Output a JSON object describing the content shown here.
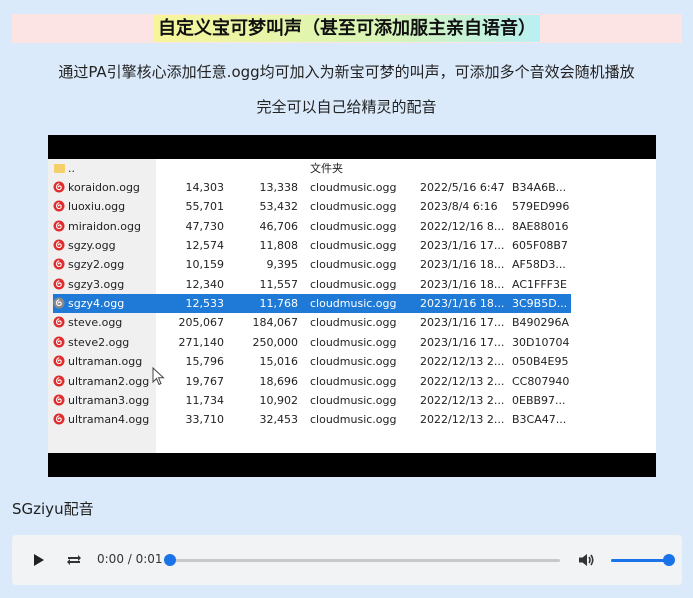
{
  "title": "自定义宝可梦叫声（甚至可添加服主亲自语音）",
  "description": {
    "line1": "通过PA引擎核心添加任意.ogg均可加入为新宝可梦的叫声，可添加多个音效会随机播放",
    "line2": "完全可以自己给精灵的配音"
  },
  "explorer": {
    "parent_name": "..",
    "folder_header": "文件夹",
    "files": [
      {
        "name": "koraidon.ogg",
        "size": "14,303",
        "packed": "13,338",
        "folder": "cloudmusic.ogg",
        "modified": "2022/5/16 6:47",
        "crc": "B34A6B..."
      },
      {
        "name": "luoxiu.ogg",
        "size": "55,701",
        "packed": "53,432",
        "folder": "cloudmusic.ogg",
        "modified": "2023/8/4 6:16",
        "crc": "579ED996"
      },
      {
        "name": "miraidon.ogg",
        "size": "47,730",
        "packed": "46,706",
        "folder": "cloudmusic.ogg",
        "modified": "2022/12/16 8...",
        "crc": "8AE88016"
      },
      {
        "name": "sgzy.ogg",
        "size": "12,574",
        "packed": "11,808",
        "folder": "cloudmusic.ogg",
        "modified": "2023/1/16 17...",
        "crc": "605F08B7"
      },
      {
        "name": "sgzy2.ogg",
        "size": "10,159",
        "packed": "9,395",
        "folder": "cloudmusic.ogg",
        "modified": "2023/1/16 18...",
        "crc": "AF58D3..."
      },
      {
        "name": "sgzy3.ogg",
        "size": "12,340",
        "packed": "11,557",
        "folder": "cloudmusic.ogg",
        "modified": "2023/1/16 18...",
        "crc": "AC1FFF3E"
      },
      {
        "name": "sgzy4.ogg",
        "size": "12,533",
        "packed": "11,768",
        "folder": "cloudmusic.ogg",
        "modified": "2023/1/16 18...",
        "crc": "3C9B5D...",
        "selected": true
      },
      {
        "name": "steve.ogg",
        "size": "205,067",
        "packed": "184,067",
        "folder": "cloudmusic.ogg",
        "modified": "2023/1/16 17...",
        "crc": "B490296A"
      },
      {
        "name": "steve2.ogg",
        "size": "271,140",
        "packed": "250,000",
        "folder": "cloudmusic.ogg",
        "modified": "2023/1/16 17...",
        "crc": "30D10704"
      },
      {
        "name": "ultraman.ogg",
        "size": "15,796",
        "packed": "15,016",
        "folder": "cloudmusic.ogg",
        "modified": "2022/12/13 2...",
        "crc": "050B4E95"
      },
      {
        "name": "ultraman2.ogg",
        "size": "19,767",
        "packed": "18,696",
        "folder": "cloudmusic.ogg",
        "modified": "2022/12/13 2...",
        "crc": "CC807940"
      },
      {
        "name": "ultraman3.ogg",
        "size": "11,734",
        "packed": "10,902",
        "folder": "cloudmusic.ogg",
        "modified": "2022/12/13 2...",
        "crc": "0EBB97..."
      },
      {
        "name": "ultraman4.ogg",
        "size": "33,710",
        "packed": "32,453",
        "folder": "cloudmusic.ogg",
        "modified": "2022/12/13 2...",
        "crc": "B3CA47..."
      }
    ]
  },
  "caption": "SGziyu配音",
  "player": {
    "time": "0:00 / 0:01",
    "progress_fraction": 0,
    "volume_fraction": 1,
    "accent_color": "#1a73e8"
  }
}
